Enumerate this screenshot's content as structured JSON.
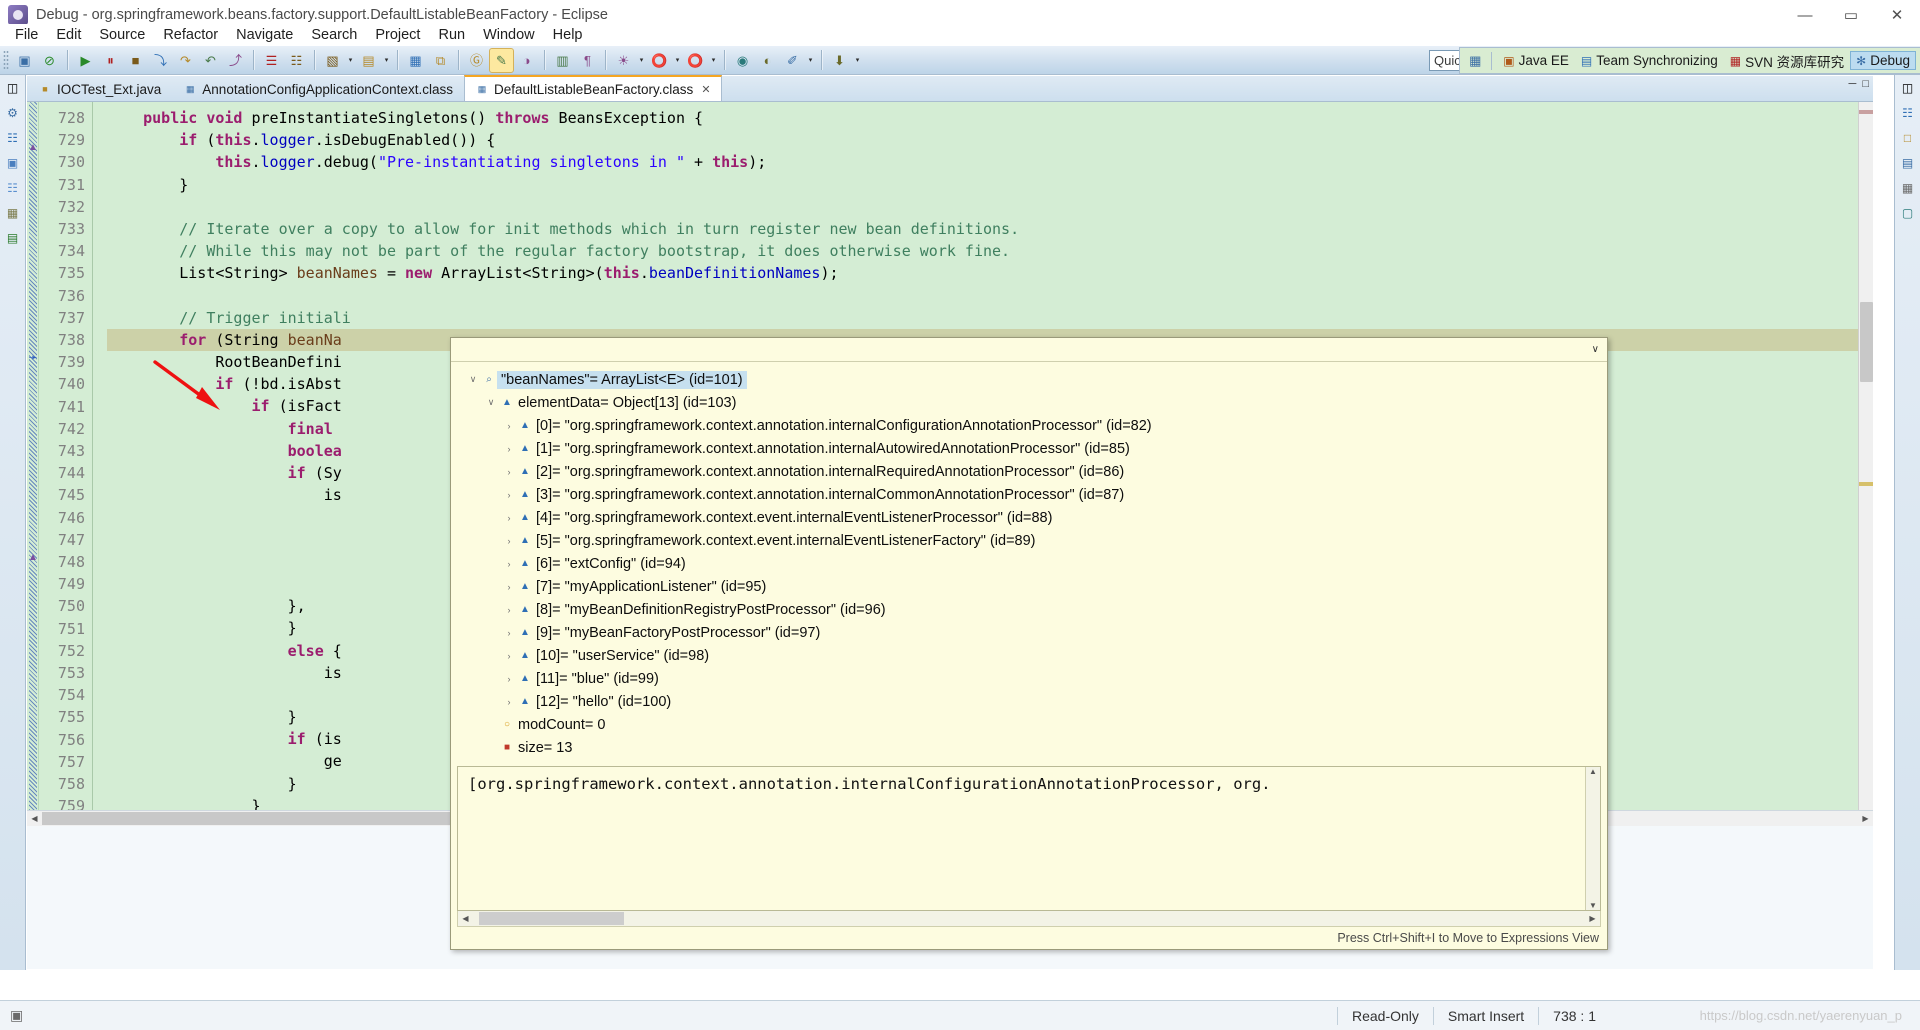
{
  "window": {
    "title": "Debug - org.springframework.beans.factory.support.DefaultListableBeanFactory - Eclipse",
    "minimize": "—",
    "maximize": "▭",
    "close": "✕"
  },
  "menu": [
    "File",
    "Edit",
    "Source",
    "Refactor",
    "Navigate",
    "Search",
    "Project",
    "Run",
    "Window",
    "Help"
  ],
  "toolbar": {
    "quick_access": "Quick Access",
    "groups": [
      [
        "▣",
        "⊘"
      ],
      [
        "▶",
        "⏸",
        "■",
        "⤵",
        "↷",
        "↶",
        "⤴"
      ],
      [
        "☰",
        "☷"
      ],
      [
        "▧",
        "▾",
        "▤",
        "▾"
      ],
      [
        "▦",
        "⧉"
      ],
      [
        "Ⓖ",
        "✎",
        "◑"
      ],
      [
        "▥",
        "¶"
      ],
      [
        "☀",
        "▾",
        "⭕",
        "▾",
        "⭕",
        "▾"
      ],
      [
        "◉",
        "◐",
        "✐",
        "▾"
      ],
      [
        "⬇",
        "▾"
      ]
    ]
  },
  "perspectives": {
    "open_icon": "open-perspective-icon",
    "items": [
      {
        "label": "Java EE",
        "icon": "java-ee-icon",
        "active": false
      },
      {
        "label": "Team Synchronizing",
        "icon": "team-sync-icon",
        "active": false
      },
      {
        "label": "SVN 资源库研究",
        "icon": "svn-icon",
        "active": false
      },
      {
        "label": "Debug",
        "icon": "debug-icon",
        "active": true
      }
    ]
  },
  "tabs": [
    {
      "label": "IOCTest_Ext.java",
      "icon": "java-file-icon",
      "active": false,
      "closable": false
    },
    {
      "label": "AnnotationConfigApplicationContext.class",
      "icon": "class-file-icon",
      "active": false,
      "closable": false
    },
    {
      "label": "DefaultListableBeanFactory.class",
      "icon": "class-file-icon",
      "active": true,
      "closable": true
    }
  ],
  "editor": {
    "first_line": 728,
    "highlighted_line": 738,
    "lines": [
      {
        "n": 728,
        "html": "    <span class='kw'>public</span> <span class='kw'>void</span> preInstantiateSingletons() <span class='kw'>throws</span> BeansException {"
      },
      {
        "n": 729,
        "html": "        <span class='kw'>if</span> (<span class='kw'>this</span>.<span class='fld'>logger</span>.isDebugEnabled()) {"
      },
      {
        "n": 730,
        "html": "            <span class='kw'>this</span>.<span class='fld'>logger</span>.debug(<span class='str'>\"Pre-instantiating singletons in \"</span> + <span class='kw'>this</span>);"
      },
      {
        "n": 731,
        "html": "        }"
      },
      {
        "n": 732,
        "html": ""
      },
      {
        "n": 733,
        "html": "        <span class='cmt'>// Iterate over a copy to allow for init methods which in turn register new bean definitions.</span>"
      },
      {
        "n": 734,
        "html": "        <span class='cmt'>// While this may not be part of the regular factory bootstrap, it does otherwise work fine.</span>"
      },
      {
        "n": 735,
        "html": "        List&lt;String&gt; <span class='loc'>beanNames</span> = <span class='kw'>new</span> ArrayList&lt;String&gt;(<span class='kw'>this</span>.<span class='fld'>beanDefinitionNames</span>);"
      },
      {
        "n": 736,
        "html": ""
      },
      {
        "n": 737,
        "html": "        <span class='cmt'>// Trigger initiali</span>"
      },
      {
        "n": 738,
        "html": "        <span class='kw'>for</span> (String <span class='loc'>beanNa</span>"
      },
      {
        "n": 739,
        "html": "            RootBeanDefini"
      },
      {
        "n": 740,
        "html": "            <span class='kw'>if</span> (!bd.isAbst"
      },
      {
        "n": 741,
        "html": "                <span class='kw'>if</span> (isFact"
      },
      {
        "n": 742,
        "html": "                    <span class='kw'>final</span>"
      },
      {
        "n": 743,
        "html": "                    <span class='kw'>boolea</span>"
      },
      {
        "n": 744,
        "html": "                    <span class='kw'>if</span> (Sy"
      },
      {
        "n": 745,
        "html": "                        is"
      },
      {
        "n": 746,
        "html": ""
      },
      {
        "n": 747,
        "html": ""
      },
      {
        "n": 748,
        "html": ""
      },
      {
        "n": 749,
        "html": ""
      },
      {
        "n": 750,
        "html": "                    },"
      },
      {
        "n": 751,
        "html": "                    }"
      },
      {
        "n": 752,
        "html": "                    <span class='kw'>else</span> {"
      },
      {
        "n": 753,
        "html": "                        is"
      },
      {
        "n": 754,
        "html": ""
      },
      {
        "n": 755,
        "html": "                    }"
      },
      {
        "n": 756,
        "html": "                    <span class='kw'>if</span> (is"
      },
      {
        "n": 757,
        "html": "                        ge"
      },
      {
        "n": 758,
        "html": "                    }"
      },
      {
        "n": 759,
        "html": "                }"
      }
    ]
  },
  "popup": {
    "collapse_icon": "∨",
    "footer_hint": "Press Ctrl+Shift+I to Move to Expressions View",
    "tree": [
      {
        "indent": 0,
        "twist": "∨",
        "icon": "magnifier-icon",
        "icon_class": "magn",
        "glyph": "⌕",
        "label": "\"beanNames\"= ArrayList<E>  (id=101)",
        "selected": true
      },
      {
        "indent": 1,
        "twist": "∨",
        "icon": "field-icon",
        "icon_class": "blue",
        "glyph": "▲",
        "label": "elementData= Object[13]  (id=103)",
        "selected": false
      },
      {
        "indent": 2,
        "twist": "›",
        "icon": "field-icon",
        "icon_class": "blue",
        "glyph": "▲",
        "label": "[0]= \"org.springframework.context.annotation.internalConfigurationAnnotationProcessor\" (id=82)",
        "selected": false
      },
      {
        "indent": 2,
        "twist": "›",
        "icon": "field-icon",
        "icon_class": "blue",
        "glyph": "▲",
        "label": "[1]= \"org.springframework.context.annotation.internalAutowiredAnnotationProcessor\" (id=85)",
        "selected": false
      },
      {
        "indent": 2,
        "twist": "›",
        "icon": "field-icon",
        "icon_class": "blue",
        "glyph": "▲",
        "label": "[2]= \"org.springframework.context.annotation.internalRequiredAnnotationProcessor\" (id=86)",
        "selected": false
      },
      {
        "indent": 2,
        "twist": "›",
        "icon": "field-icon",
        "icon_class": "blue",
        "glyph": "▲",
        "label": "[3]= \"org.springframework.context.annotation.internalCommonAnnotationProcessor\" (id=87)",
        "selected": false
      },
      {
        "indent": 2,
        "twist": "›",
        "icon": "field-icon",
        "icon_class": "blue",
        "glyph": "▲",
        "label": "[4]= \"org.springframework.context.event.internalEventListenerProcessor\" (id=88)",
        "selected": false
      },
      {
        "indent": 2,
        "twist": "›",
        "icon": "field-icon",
        "icon_class": "blue",
        "glyph": "▲",
        "label": "[5]= \"org.springframework.context.event.internalEventListenerFactory\" (id=89)",
        "selected": false
      },
      {
        "indent": 2,
        "twist": "›",
        "icon": "field-icon",
        "icon_class": "blue",
        "glyph": "▲",
        "label": "[6]= \"extConfig\" (id=94)",
        "selected": false
      },
      {
        "indent": 2,
        "twist": "›",
        "icon": "field-icon",
        "icon_class": "blue",
        "glyph": "▲",
        "label": "[7]= \"myApplicationListener\" (id=95)",
        "selected": false
      },
      {
        "indent": 2,
        "twist": "›",
        "icon": "field-icon",
        "icon_class": "blue",
        "glyph": "▲",
        "label": "[8]= \"myBeanDefinitionRegistryPostProcessor\" (id=96)",
        "selected": false
      },
      {
        "indent": 2,
        "twist": "›",
        "icon": "field-icon",
        "icon_class": "blue",
        "glyph": "▲",
        "label": "[9]= \"myBeanFactoryPostProcessor\" (id=97)",
        "selected": false
      },
      {
        "indent": 2,
        "twist": "›",
        "icon": "field-icon",
        "icon_class": "blue",
        "glyph": "▲",
        "label": "[10]= \"userService\" (id=98)",
        "selected": false
      },
      {
        "indent": 2,
        "twist": "›",
        "icon": "field-icon",
        "icon_class": "blue",
        "glyph": "▲",
        "label": "[11]= \"blue\" (id=99)",
        "selected": false
      },
      {
        "indent": 2,
        "twist": "›",
        "icon": "field-icon",
        "icon_class": "blue",
        "glyph": "▲",
        "label": "[12]= \"hello\" (id=100)",
        "selected": false
      },
      {
        "indent": 1,
        "twist": "",
        "icon": "transient-field-icon",
        "icon_class": "orange",
        "glyph": "○",
        "label": "modCount= 0",
        "selected": false
      },
      {
        "indent": 1,
        "twist": "",
        "icon": "private-field-icon",
        "icon_class": "red",
        "glyph": "■",
        "label": "size= 13",
        "selected": false
      }
    ],
    "detail_text": "[org.springframework.context.annotation.internalConfigurationAnnotationProcessor, org."
  },
  "statusbar": {
    "read_only": "Read-Only",
    "insert_mode": "Smart Insert",
    "cursor_position": "738 : 1",
    "watermark": "https://blog.csdn.net/yaerenyuan_p"
  },
  "colors": {
    "code_background": "#d4edd4",
    "popup_background": "#fdfce0",
    "highlight_line": "#ccd1a8",
    "annotation_red": "#ee1111",
    "selection_blue": "#c6e0ef",
    "perspective_bar": "#d9ecd2",
    "active_perspective": "#bcdcf0"
  }
}
